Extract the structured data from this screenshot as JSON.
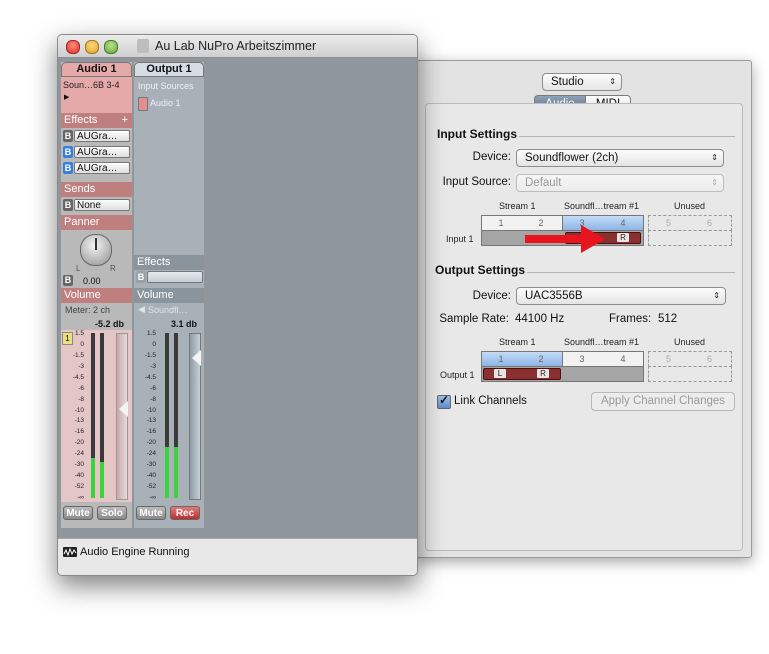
{
  "mixer": {
    "title": "Au Lab NuPro Arbeitszimmer",
    "strip1": {
      "name": "Audio 1",
      "source": "Soun…6B 3-4",
      "effects_label": "Effects",
      "effects_add": "+",
      "effects": [
        {
          "badge": "B",
          "name": "AUGra…"
        },
        {
          "badge": "B",
          "name": "AUGra…"
        },
        {
          "badge": "B",
          "name": "AUGra…"
        }
      ],
      "sends_label": "Sends",
      "send": {
        "badge": "B",
        "name": "None"
      },
      "panner_label": "Panner",
      "pan_value": "0.00",
      "pan_left": "L",
      "pan_right": "R",
      "pan_badge": "B",
      "volume_label": "Volume",
      "meter_info": "Meter: 2 ch",
      "level": "-5.2 db",
      "mute": "Mute",
      "solo": "Solo",
      "track_number": "1"
    },
    "strip2": {
      "name": "Output 1",
      "input_sources_label": "Input Sources",
      "input_item": "Audio 1",
      "effects_label": "Effects",
      "effects_badge": "B",
      "volume_label": "Volume",
      "source": "Soundfl…",
      "level": "3.1 db",
      "mute": "Mute",
      "rec": "Rec"
    },
    "scale_ticks": [
      "1.5",
      "0",
      "-1.5",
      "-3",
      "-4.5",
      "-6",
      "-8",
      "-10",
      "-13",
      "-16",
      "-20",
      "-24",
      "-30",
      "-40",
      "-52",
      "-∞"
    ],
    "status": "Audio Engine Running"
  },
  "settings": {
    "device_popup": "Studio",
    "tabs": [
      "Audio",
      "MIDI"
    ],
    "input_settings_title": "Input Settings",
    "device_label": "Device:",
    "input_device": "Soundflower (2ch)",
    "input_source_label": "Input Source:",
    "input_source": "Default",
    "in_stream1": "Stream 1",
    "in_stream2": "Soundfl…tream #1",
    "in_unused": "Unused",
    "in_channels": [
      "1",
      "2",
      "3",
      "4",
      "5",
      "6"
    ],
    "in_row_label": "Input 1",
    "in_marker": "R",
    "output_settings_title": "Output Settings",
    "output_device": "UAC3556B",
    "sample_rate_label": "Sample Rate:",
    "sample_rate": "44100 Hz",
    "frames_label": "Frames:",
    "frames": "512",
    "out_stream1": "Stream 1",
    "out_stream2": "Soundfl…tream #1",
    "out_unused": "Unused",
    "out_channels": [
      "1",
      "2",
      "3",
      "4",
      "5",
      "6"
    ],
    "out_row_label": "Output 1",
    "out_markers": [
      "L",
      "R"
    ],
    "link_channels": "Link Channels",
    "apply_button": "Apply Channel Changes"
  },
  "colors": {
    "strip_header_pink": "#e6a9a9",
    "section_pink": "#c07f7f",
    "section_gray": "#8a949c",
    "stream_blue": "#a8c8ee",
    "meter_green": "#3bd43b",
    "rec_red": "#d84a4a",
    "arrow_red": "#e8141e"
  },
  "meters": {
    "input_left_level": 0.24,
    "input_right_level": 0.22,
    "output_left_level": 0.31,
    "output_right_level": 0.31
  }
}
